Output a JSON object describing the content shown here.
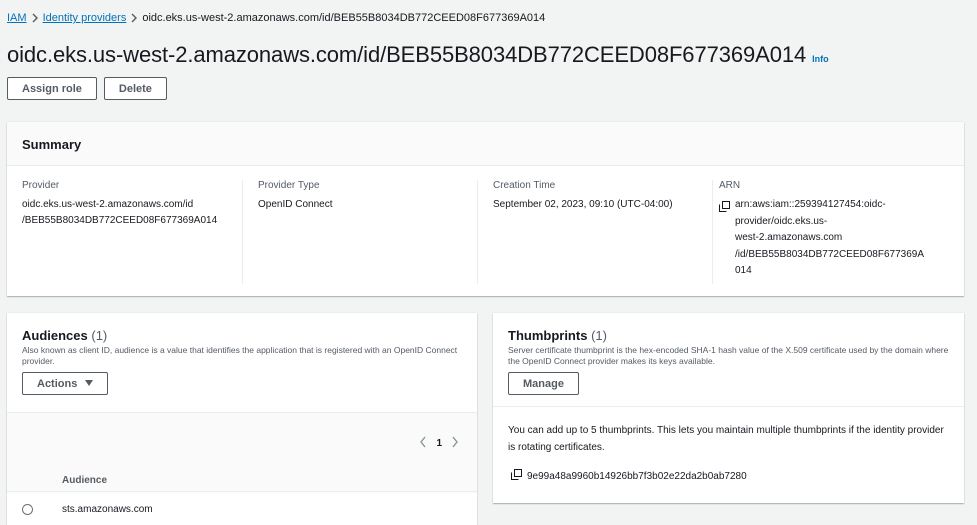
{
  "breadcrumb": {
    "items": [
      "IAM",
      "Identity providers"
    ],
    "current": "oidc.eks.us-west-2.amazonaws.com/id/BEB55B8034DB772CEED08F677369A014"
  },
  "title": "oidc.eks.us-west-2.amazonaws.com/id/BEB55B8034DB772CEED08F677369A014",
  "info_label": "Info",
  "buttons": {
    "assign_role": "Assign role",
    "delete": "Delete"
  },
  "summary": {
    "heading": "Summary",
    "provider_label": "Provider",
    "provider_value": "oidc.eks.us-west-2.amazonaws.com/id\n/BEB55B8034DB772CEED08F677369A014",
    "provider_line1": "oidc.eks.us-west-2.amazonaws.com/id",
    "provider_line2": "/BEB55B8034DB772CEED08F677369A014",
    "type_label": "Provider Type",
    "type_value": "OpenID Connect",
    "creation_label": "Creation Time",
    "creation_value": "September 02, 2023, 09:10 (UTC-04:00)",
    "arn_label": "ARN",
    "arn_lines": [
      "arn:aws:iam::259394127454:oidc-",
      "provider/oidc.eks.us-",
      "west-2.amazonaws.com",
      "/id/BEB55B8034DB772CEED08F677369A",
      "014"
    ]
  },
  "audiences": {
    "title": "Audiences",
    "count": "(1)",
    "description": "Also known as client ID, audience is a value that identifies the application that is registered with an OpenID Connect provider.",
    "actions_label": "Actions",
    "page": "1",
    "column_header": "Audience",
    "rows": [
      "sts.amazonaws.com"
    ]
  },
  "thumbprints": {
    "title": "Thumbprints",
    "count": "(1)",
    "description": "Server certificate thumbprint is the hex-encoded SHA-1 hash value of the X.509 certificate used by the domain where the OpenID Connect provider makes its keys available.",
    "manage_label": "Manage",
    "message": "You can add up to 5 thumbprints. This lets you maintain multiple thumbprints if the identity provider is rotating certificates.",
    "items": [
      "9e99a48a9960b14926bb7f3b02e22da2b0ab7280"
    ]
  },
  "colors": {
    "link": "#0073bb",
    "text": "#16191f",
    "secondary": "#545b64",
    "background": "#f2f3f3"
  },
  "icons": [
    "chevron-right-icon",
    "caret-down-icon",
    "chevron-left-icon",
    "copy-icon"
  ]
}
